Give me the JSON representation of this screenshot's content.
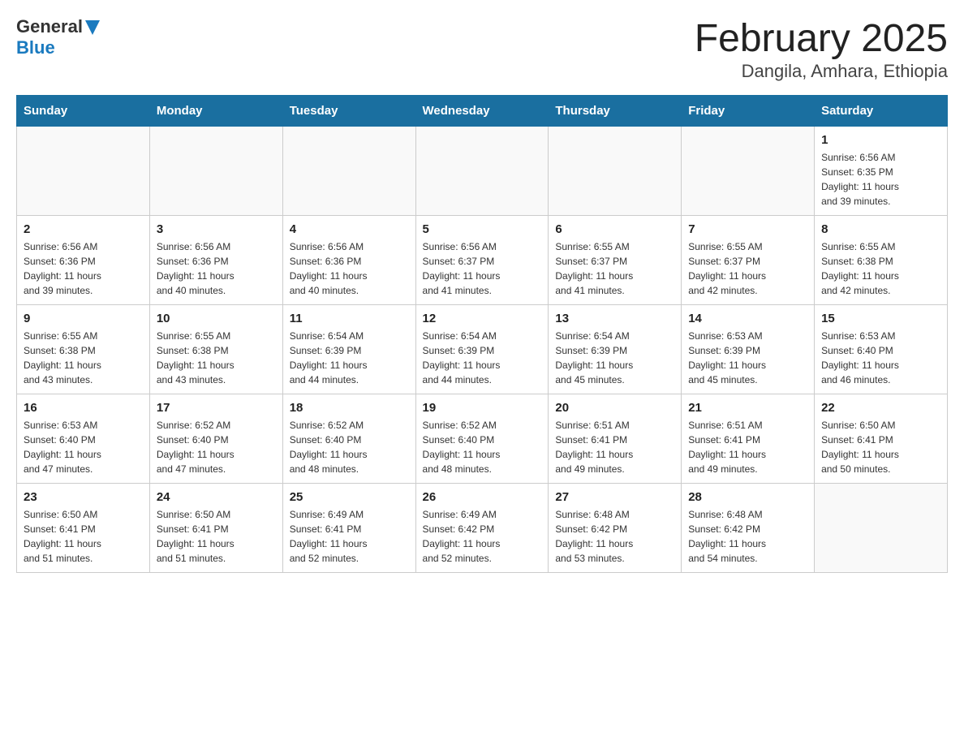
{
  "header": {
    "logo_general": "General",
    "logo_blue": "Blue",
    "title": "February 2025",
    "subtitle": "Dangila, Amhara, Ethiopia"
  },
  "calendar": {
    "days_of_week": [
      "Sunday",
      "Monday",
      "Tuesday",
      "Wednesday",
      "Thursday",
      "Friday",
      "Saturday"
    ],
    "weeks": [
      [
        {
          "day": "",
          "info": ""
        },
        {
          "day": "",
          "info": ""
        },
        {
          "day": "",
          "info": ""
        },
        {
          "day": "",
          "info": ""
        },
        {
          "day": "",
          "info": ""
        },
        {
          "day": "",
          "info": ""
        },
        {
          "day": "1",
          "info": "Sunrise: 6:56 AM\nSunset: 6:35 PM\nDaylight: 11 hours\nand 39 minutes."
        }
      ],
      [
        {
          "day": "2",
          "info": "Sunrise: 6:56 AM\nSunset: 6:36 PM\nDaylight: 11 hours\nand 39 minutes."
        },
        {
          "day": "3",
          "info": "Sunrise: 6:56 AM\nSunset: 6:36 PM\nDaylight: 11 hours\nand 40 minutes."
        },
        {
          "day": "4",
          "info": "Sunrise: 6:56 AM\nSunset: 6:36 PM\nDaylight: 11 hours\nand 40 minutes."
        },
        {
          "day": "5",
          "info": "Sunrise: 6:56 AM\nSunset: 6:37 PM\nDaylight: 11 hours\nand 41 minutes."
        },
        {
          "day": "6",
          "info": "Sunrise: 6:55 AM\nSunset: 6:37 PM\nDaylight: 11 hours\nand 41 minutes."
        },
        {
          "day": "7",
          "info": "Sunrise: 6:55 AM\nSunset: 6:37 PM\nDaylight: 11 hours\nand 42 minutes."
        },
        {
          "day": "8",
          "info": "Sunrise: 6:55 AM\nSunset: 6:38 PM\nDaylight: 11 hours\nand 42 minutes."
        }
      ],
      [
        {
          "day": "9",
          "info": "Sunrise: 6:55 AM\nSunset: 6:38 PM\nDaylight: 11 hours\nand 43 minutes."
        },
        {
          "day": "10",
          "info": "Sunrise: 6:55 AM\nSunset: 6:38 PM\nDaylight: 11 hours\nand 43 minutes."
        },
        {
          "day": "11",
          "info": "Sunrise: 6:54 AM\nSunset: 6:39 PM\nDaylight: 11 hours\nand 44 minutes."
        },
        {
          "day": "12",
          "info": "Sunrise: 6:54 AM\nSunset: 6:39 PM\nDaylight: 11 hours\nand 44 minutes."
        },
        {
          "day": "13",
          "info": "Sunrise: 6:54 AM\nSunset: 6:39 PM\nDaylight: 11 hours\nand 45 minutes."
        },
        {
          "day": "14",
          "info": "Sunrise: 6:53 AM\nSunset: 6:39 PM\nDaylight: 11 hours\nand 45 minutes."
        },
        {
          "day": "15",
          "info": "Sunrise: 6:53 AM\nSunset: 6:40 PM\nDaylight: 11 hours\nand 46 minutes."
        }
      ],
      [
        {
          "day": "16",
          "info": "Sunrise: 6:53 AM\nSunset: 6:40 PM\nDaylight: 11 hours\nand 47 minutes."
        },
        {
          "day": "17",
          "info": "Sunrise: 6:52 AM\nSunset: 6:40 PM\nDaylight: 11 hours\nand 47 minutes."
        },
        {
          "day": "18",
          "info": "Sunrise: 6:52 AM\nSunset: 6:40 PM\nDaylight: 11 hours\nand 48 minutes."
        },
        {
          "day": "19",
          "info": "Sunrise: 6:52 AM\nSunset: 6:40 PM\nDaylight: 11 hours\nand 48 minutes."
        },
        {
          "day": "20",
          "info": "Sunrise: 6:51 AM\nSunset: 6:41 PM\nDaylight: 11 hours\nand 49 minutes."
        },
        {
          "day": "21",
          "info": "Sunrise: 6:51 AM\nSunset: 6:41 PM\nDaylight: 11 hours\nand 49 minutes."
        },
        {
          "day": "22",
          "info": "Sunrise: 6:50 AM\nSunset: 6:41 PM\nDaylight: 11 hours\nand 50 minutes."
        }
      ],
      [
        {
          "day": "23",
          "info": "Sunrise: 6:50 AM\nSunset: 6:41 PM\nDaylight: 11 hours\nand 51 minutes."
        },
        {
          "day": "24",
          "info": "Sunrise: 6:50 AM\nSunset: 6:41 PM\nDaylight: 11 hours\nand 51 minutes."
        },
        {
          "day": "25",
          "info": "Sunrise: 6:49 AM\nSunset: 6:41 PM\nDaylight: 11 hours\nand 52 minutes."
        },
        {
          "day": "26",
          "info": "Sunrise: 6:49 AM\nSunset: 6:42 PM\nDaylight: 11 hours\nand 52 minutes."
        },
        {
          "day": "27",
          "info": "Sunrise: 6:48 AM\nSunset: 6:42 PM\nDaylight: 11 hours\nand 53 minutes."
        },
        {
          "day": "28",
          "info": "Sunrise: 6:48 AM\nSunset: 6:42 PM\nDaylight: 11 hours\nand 54 minutes."
        },
        {
          "day": "",
          "info": ""
        }
      ]
    ]
  }
}
